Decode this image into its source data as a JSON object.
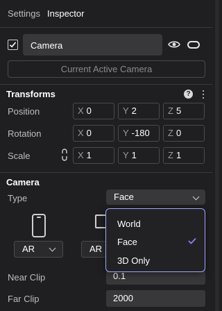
{
  "tabs": {
    "settings": "Settings",
    "inspector": "Inspector"
  },
  "object": {
    "enabled": true,
    "name": "Camera"
  },
  "active_camera_button": "Current Active Camera",
  "transforms": {
    "title": "Transforms",
    "help": "?",
    "position": {
      "label": "Position",
      "x": "0",
      "y": "2",
      "z": "5"
    },
    "rotation": {
      "label": "Rotation",
      "x": "0",
      "y": "-180",
      "z": "0"
    },
    "scale": {
      "label": "Scale",
      "x": "1",
      "y": "1",
      "z": "1"
    },
    "axis_labels": {
      "x": "X",
      "y": "Y",
      "z": "Z"
    }
  },
  "camera": {
    "title": "Camera",
    "type_label": "Type",
    "type_value": "Face",
    "device_buttons": [
      "AR",
      "AR"
    ],
    "near_clip_label": "Near Clip",
    "near_clip_value": "0.1",
    "far_clip_label": "Far Clip",
    "far_clip_value": "2000"
  },
  "type_dropdown": {
    "options": [
      "World",
      "Face",
      "3D Only"
    ],
    "selected": "Face"
  },
  "icons": {
    "checkbox": "checkbox-checked-icon",
    "visibility": "eye-icon",
    "toggle": "pill-icon",
    "help": "help-icon",
    "menu": "kebab-icon",
    "lock": "link-icon",
    "device_phone": "phone-icon",
    "device_desktop": "monitor-icon",
    "selected_mark": "check-icon"
  },
  "colors": {
    "background": "#1f1f21",
    "field": "#38383b",
    "border": "#4a4a4e",
    "accent": "#9fa8ff",
    "check": "#8f7dff"
  }
}
